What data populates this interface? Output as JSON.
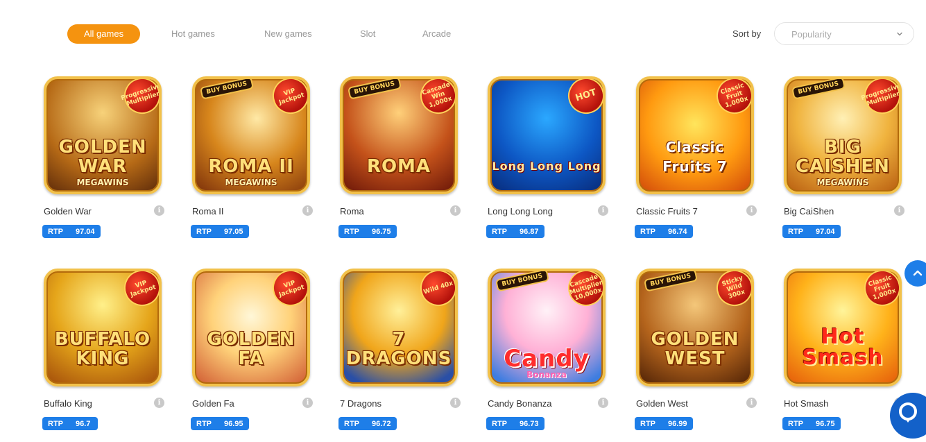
{
  "filters": {
    "tabs": [
      "All games",
      "Hot games",
      "New games",
      "Slot",
      "Arcade"
    ],
    "active": "All games"
  },
  "sort": {
    "label": "Sort by",
    "value": "Popularity"
  },
  "games": [
    {
      "name": "Golden War",
      "rtp_label": "RTP",
      "rtp": "97.04",
      "art_title": "GOLDEN WAR",
      "art_sub": "MEGAWINS",
      "badge": "Progressive Multiplier"
    },
    {
      "name": "Roma II",
      "rtp_label": "RTP",
      "rtp": "97.05",
      "art_title": "ROMA II",
      "art_sub": "MEGAWINS",
      "badge": "VIP Jackpot",
      "tag": "BUY BONUS"
    },
    {
      "name": "Roma",
      "rtp_label": "RTP",
      "rtp": "96.75",
      "art_title": "ROMA",
      "badge": "Cascade Win 1,000x",
      "tag": "BUY BONUS"
    },
    {
      "name": "Long Long Long",
      "rtp_label": "RTP",
      "rtp": "96.87",
      "art_title": "Long Long Long",
      "badge": "HOT"
    },
    {
      "name": "Classic Fruits 7",
      "rtp_label": "RTP",
      "rtp": "96.74",
      "art_title": "Classic Fruits 7",
      "badge": "Classic Fruit 1,000x"
    },
    {
      "name": "Big CaiShen",
      "rtp_label": "RTP",
      "rtp": "97.04",
      "art_title": "BIG CAISHEN",
      "art_sub": "MEGAWINS",
      "badge": "Progressive Multiplier",
      "tag": "BUY BONUS"
    },
    {
      "name": "Buffalo King",
      "rtp_label": "RTP",
      "rtp": "96.7",
      "art_title": "BUFFALO KING",
      "badge": "VIP Jackpot"
    },
    {
      "name": "Golden Fa",
      "rtp_label": "RTP",
      "rtp": "96.95",
      "art_title": "GOLDEN FA",
      "badge": "VIP Jackpot"
    },
    {
      "name": "7 Dragons",
      "rtp_label": "RTP",
      "rtp": "96.72",
      "art_title": "7 DRAGONS",
      "badge": "Wild 40x"
    },
    {
      "name": "Candy Bonanza",
      "rtp_label": "RTP",
      "rtp": "96.73",
      "art_title": "Candy",
      "art_sub": "Bonanza",
      "badge": "Cascade Multiplier 10,000x",
      "tag": "BUY BONUS"
    },
    {
      "name": "Golden West",
      "rtp_label": "RTP",
      "rtp": "96.99",
      "art_title": "GOLDEN WEST",
      "badge": "Sticky Wild 300x",
      "tag": "BUY BONUS"
    },
    {
      "name": "Hot Smash",
      "rtp_label": "RTP",
      "rtp": "96.75",
      "art_title": "Hot Smash",
      "badge": "Classic Fruit 1,000x"
    }
  ],
  "info_glyph": "i"
}
